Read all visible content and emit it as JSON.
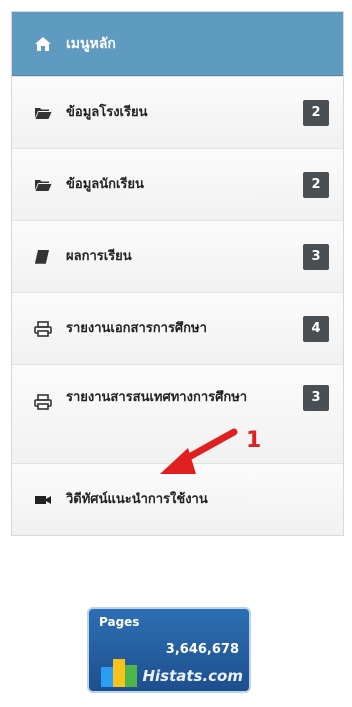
{
  "menu": {
    "header": {
      "label": "เมนูหลัก",
      "icon": "home-icon"
    },
    "items": [
      {
        "label": "ข้อมูลโรงเรียน",
        "icon": "folder-open-icon",
        "badge": "2"
      },
      {
        "label": "ข้อมูลนักเรียน",
        "icon": "folder-open-icon",
        "badge": "2"
      },
      {
        "label": "ผลการเรียน",
        "icon": "book-icon",
        "badge": "3"
      },
      {
        "label": "รายงานเอกสารการศึกษา",
        "icon": "printer-icon",
        "badge": "4"
      },
      {
        "label": "รายงานสารสนเทศทางการศึกษา",
        "icon": "printer-icon",
        "badge": "3"
      },
      {
        "label": "วิดีทัศน์แนะนำการใช้งาน",
        "icon": "video-camera-icon",
        "badge": null
      }
    ]
  },
  "annotation": {
    "number": "1",
    "color": "#e02020"
  },
  "counter": {
    "label": "Pages",
    "count": "3,646,678",
    "brand": "Histats.com"
  },
  "colors": {
    "header": "#5f9bc0",
    "badge": "#4a4f54"
  }
}
